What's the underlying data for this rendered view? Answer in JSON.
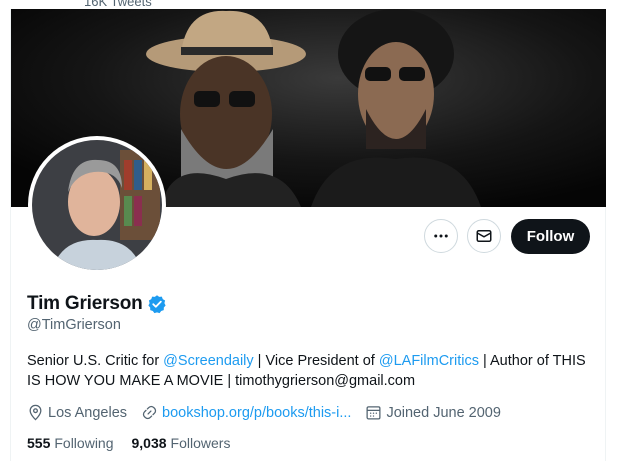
{
  "top_strip": {
    "tweets_count": "16K Tweets"
  },
  "profile": {
    "name": "Tim Grierson",
    "handle": "@TimGrierson",
    "verified": true,
    "bio": {
      "part1": "Senior U.S. Critic for ",
      "mention1": "@Screendaily",
      "part2": " | Vice President of ",
      "mention2": "@LAFilmCritics",
      "part3": " | Author of THIS IS HOW YOU MAKE A MOVIE | timothygrierson@gmail.com"
    },
    "location": "Los Angeles",
    "website": "bookshop.org/p/books/this-i...",
    "joined": "Joined June 2009",
    "following_count": "555",
    "following_label": "Following",
    "followers_count": "9,038",
    "followers_label": "Followers"
  },
  "actions": {
    "more_icon": "more-horizontal-icon",
    "message_icon": "envelope-icon",
    "follow_label": "Follow"
  },
  "colors": {
    "accent": "#1d9bf0",
    "text": "#0f1419",
    "secondary": "#536471",
    "follow_bg": "#0f1419"
  }
}
